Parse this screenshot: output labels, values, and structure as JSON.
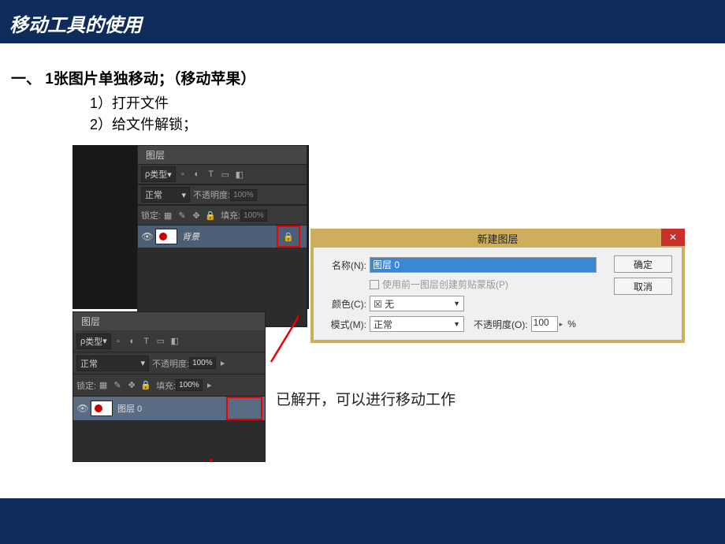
{
  "header": {
    "title": "移动工具的使用"
  },
  "section": {
    "title": "一、 1张图片单独移动；（移动苹果）",
    "step1": "1）打开文件",
    "step2": "2）给文件解锁；"
  },
  "layers_panel": {
    "tab": "图层",
    "filter_label": "类型",
    "blend_mode": "正常",
    "opacity_label": "不透明度:",
    "opacity_value": "100%",
    "lock_label": "锁定:",
    "fill_label": "填充:",
    "fill_value": "100%",
    "layer_bg_name": "背景",
    "layer_0_name": "图层 0"
  },
  "dialog": {
    "title": "新建图层",
    "name_label": "名称(N):",
    "name_value": "图层 0",
    "clip_checkbox": "使用前一图层创建剪贴蒙版(P)",
    "color_label": "颜色(C):",
    "color_value": "无",
    "mode_label": "模式(M):",
    "mode_value": "正常",
    "opacity_label": "不透明度(O):",
    "opacity_value": "100",
    "percent": "%",
    "ok": "确定",
    "cancel": "取消"
  },
  "note": "已解开，可以进行移动工作"
}
